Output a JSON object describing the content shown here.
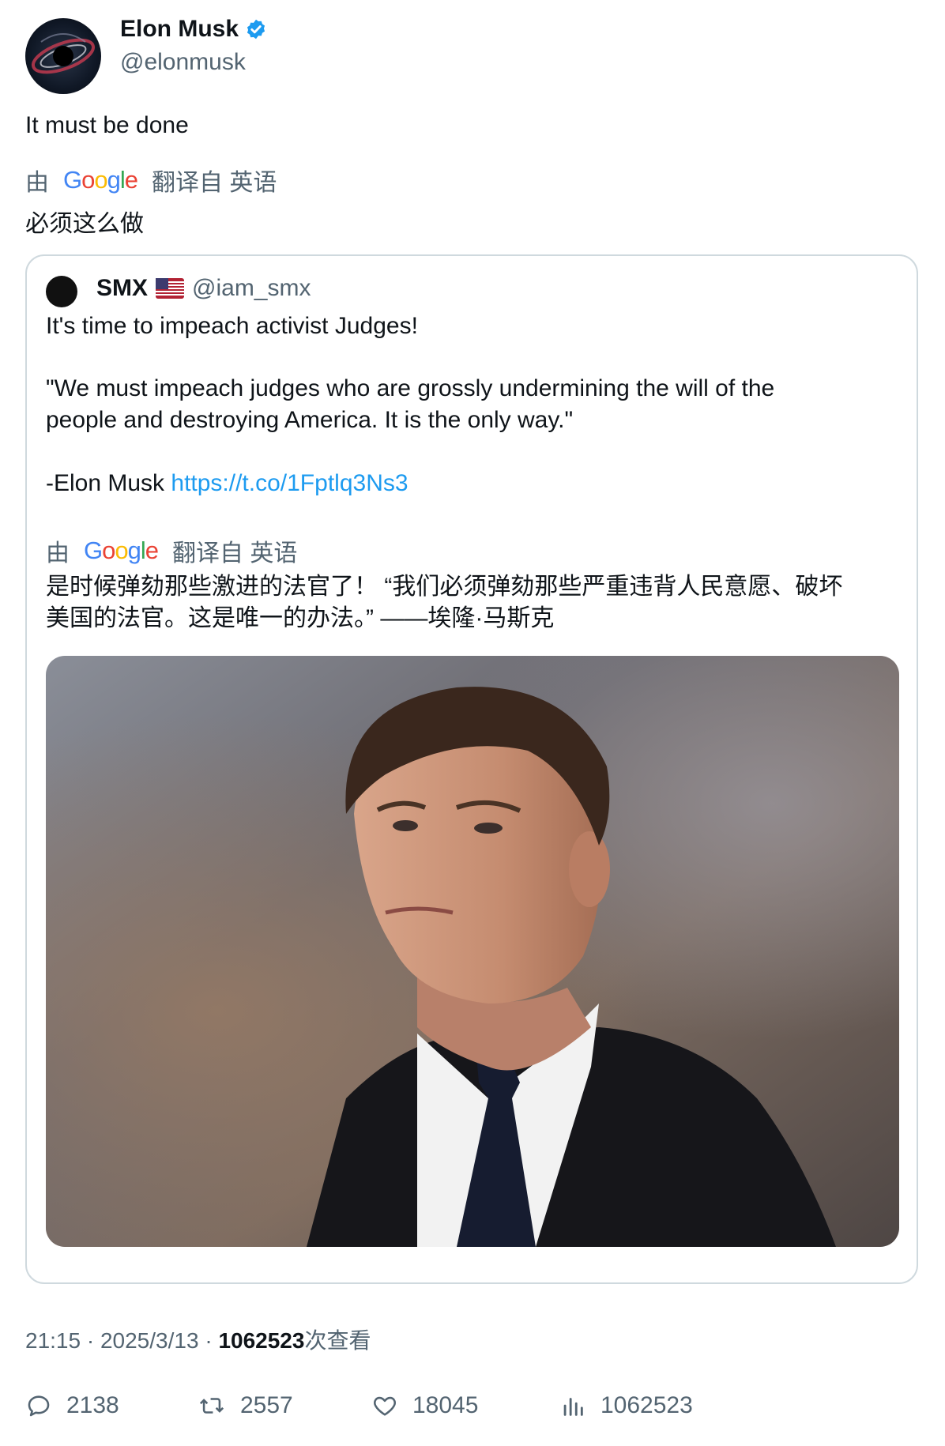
{
  "author": {
    "name": "Elon Musk",
    "handle": "@elonmusk",
    "verified_icon": "verified-badge-icon"
  },
  "tweet": {
    "text": "It must be done"
  },
  "translation": {
    "by": "由",
    "google": [
      "G",
      "o",
      "o",
      "g",
      "l",
      "e"
    ],
    "from_label": "翻译自 英语",
    "text": "必须这么做"
  },
  "quote": {
    "name": "SMX",
    "flag_icon": "us-flag-icon",
    "handle": "@iam_smx",
    "line1": "It's time to impeach activist Judges!",
    "line2": "\"We must impeach judges who are grossly undermining the will of the",
    "line3": "people and destroying America. It is the only way.\"",
    "line4": "-Elon Musk",
    "link": "https://t.co/1Fptlq3Ns3",
    "translation": {
      "by": "由",
      "from_label": "翻译自 英语",
      "text1": "是时候弹劾那些激进的法官了！ “我们必须弹劾那些严重违背人民意愿、破坏",
      "text2": "美国的法官。这是唯一的办法。” ——埃隆·马斯克"
    }
  },
  "meta": {
    "time": "21:15",
    "sep": "·",
    "date": "2025/3/13",
    "views": "1062523",
    "views_suffix": "次查看"
  },
  "actions": {
    "replies": "2138",
    "reposts": "2557",
    "likes": "18045",
    "views": "1062523"
  },
  "colors": {
    "accent": "#1d9bf0",
    "text": "#0f1419",
    "muted": "#536471",
    "border": "#cfd9de"
  }
}
